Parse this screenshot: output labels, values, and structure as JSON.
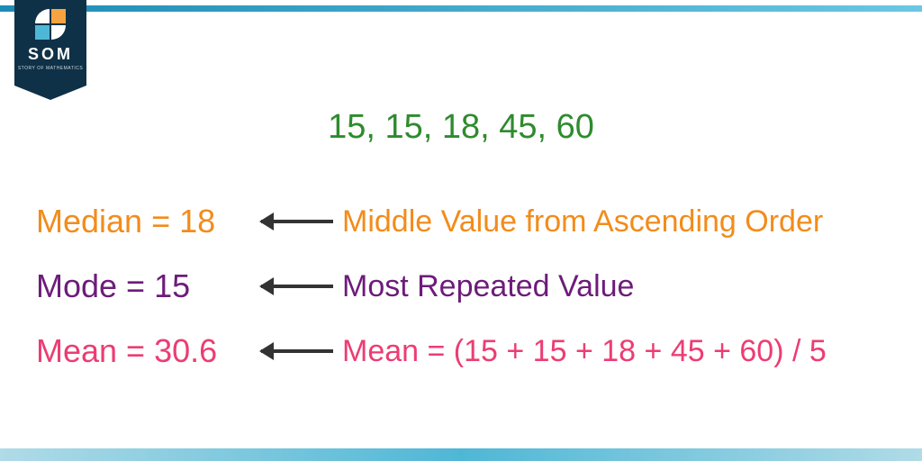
{
  "brand": {
    "name": "SOM",
    "tagline": "STORY OF MATHEMATICS"
  },
  "data_list": "15, 15, 18, 45, 60",
  "rows": {
    "median": {
      "lhs": "Median = 18",
      "rhs": "Middle Value from Ascending Order",
      "color": "c-orange"
    },
    "mode": {
      "lhs": "Mode = 15",
      "rhs": "Most Repeated Value",
      "color": "c-purple"
    },
    "mean": {
      "lhs": "Mean = 30.6",
      "rhs": "Mean = (15 + 15 + 18 + 45 + 60) / 5",
      "color": "c-pink"
    }
  }
}
